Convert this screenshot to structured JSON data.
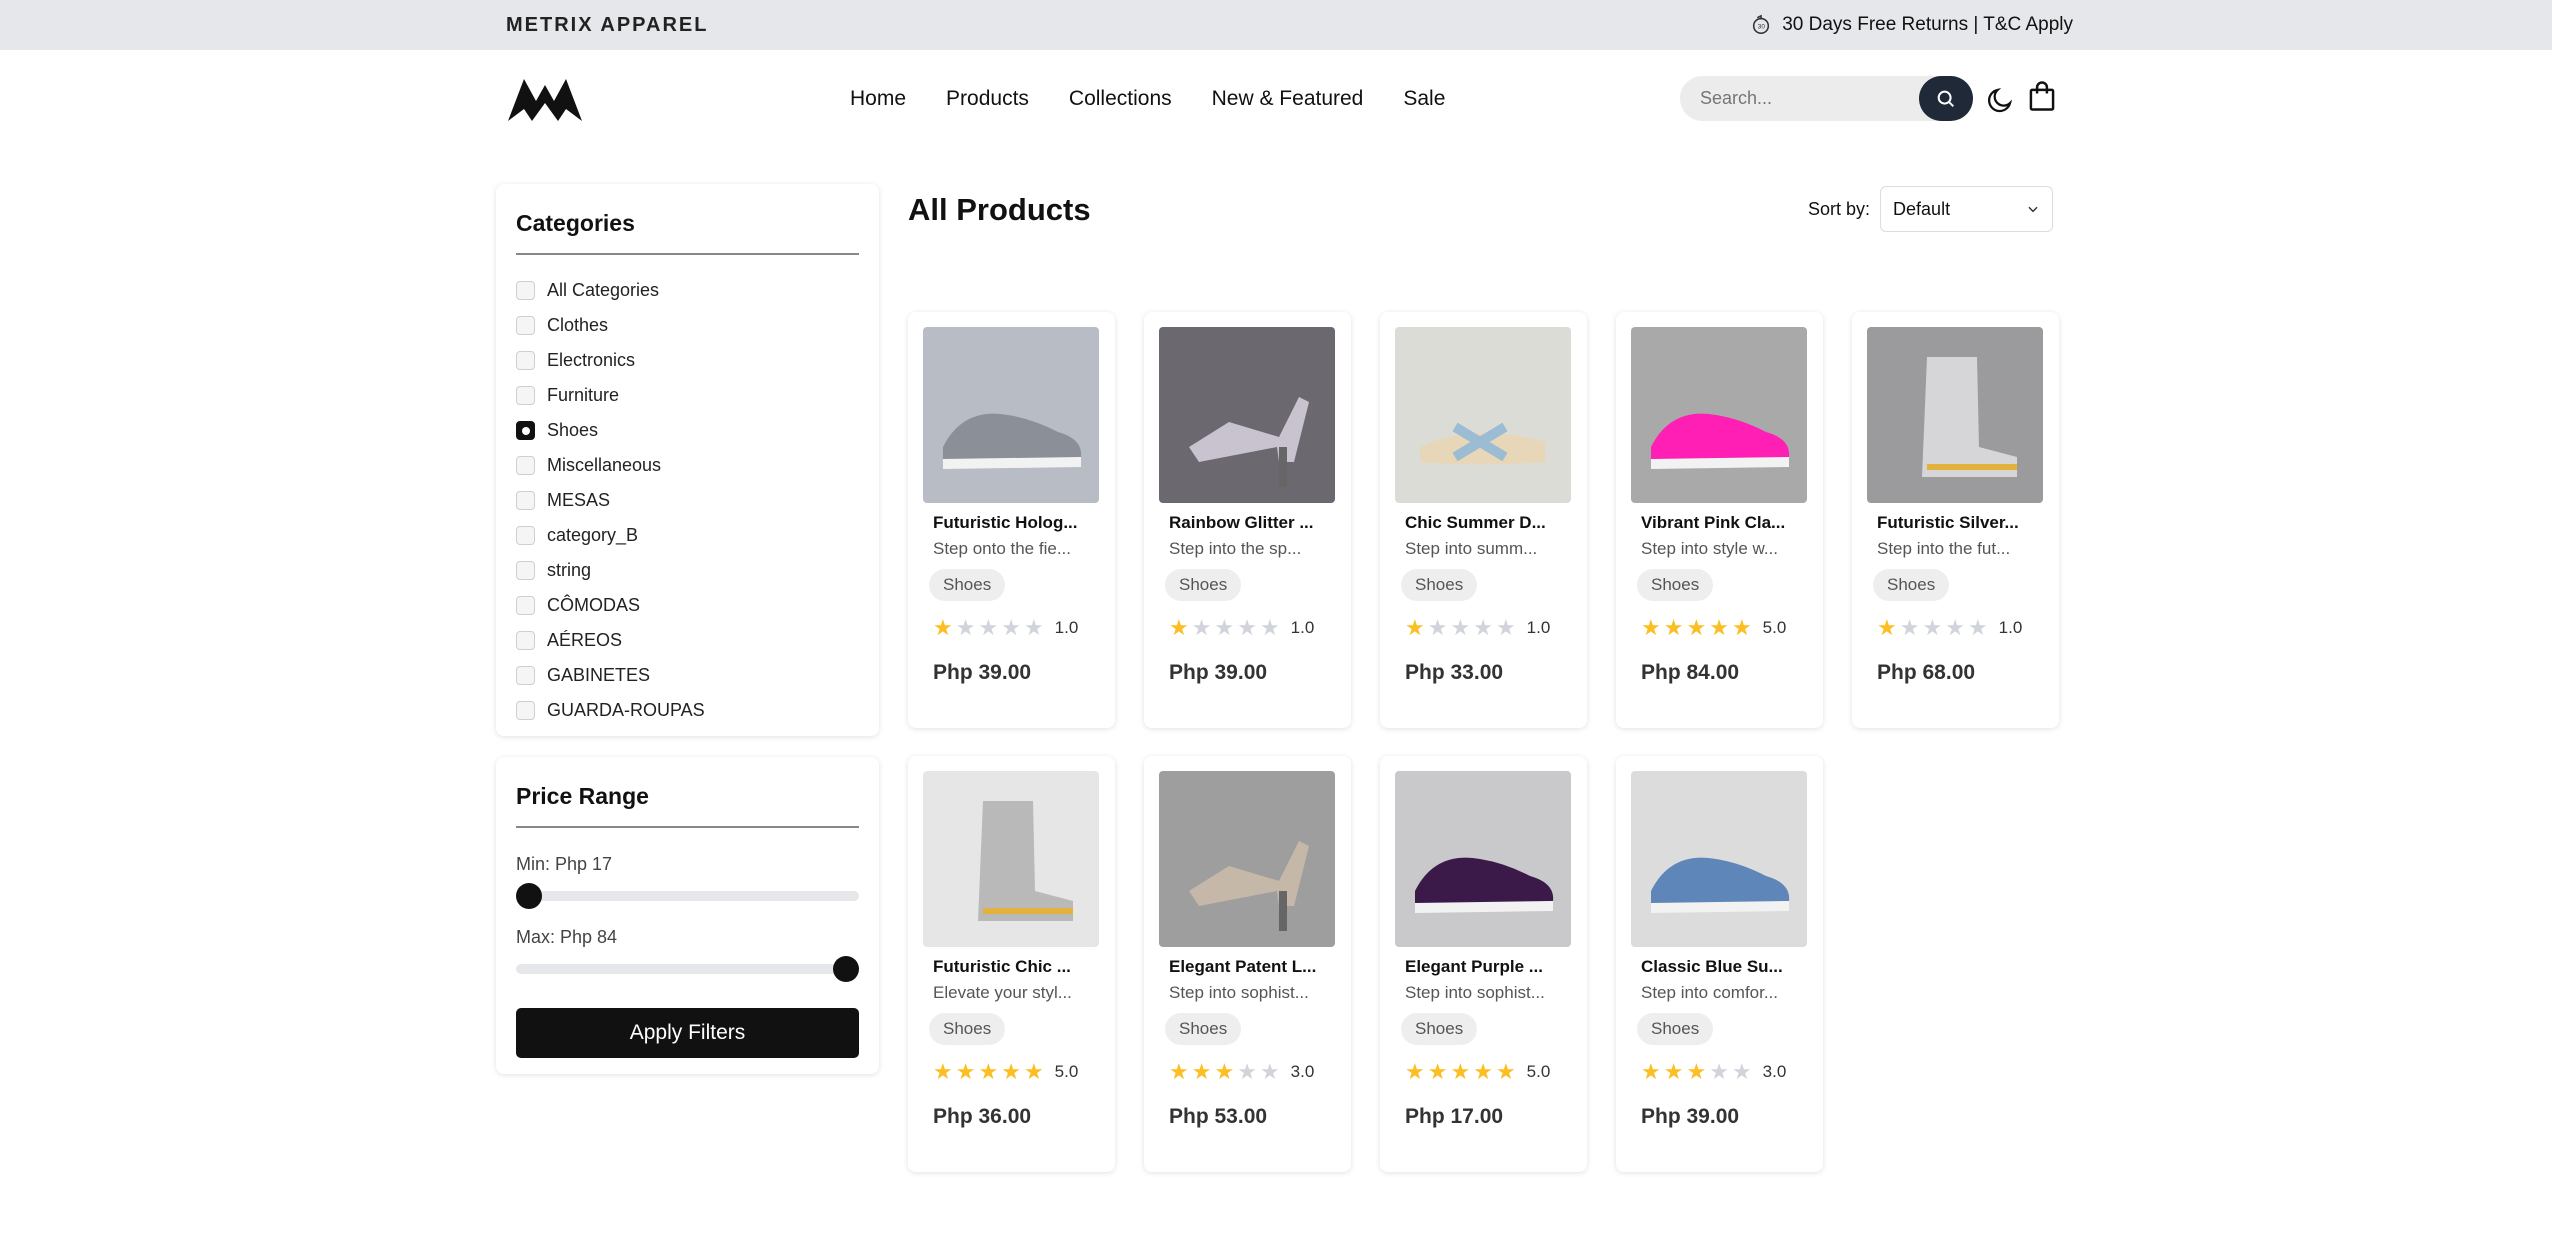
{
  "topbar": {
    "brand": "METRIX APPAREL",
    "promo": "30 Days Free Returns | T&C Apply"
  },
  "nav": [
    "Home",
    "Products",
    "Collections",
    "New & Featured",
    "Sale"
  ],
  "search": {
    "placeholder": "Search..."
  },
  "categories": {
    "title": "Categories",
    "items": [
      {
        "label": "All Categories",
        "checked": false
      },
      {
        "label": "Clothes",
        "checked": false
      },
      {
        "label": "Electronics",
        "checked": false
      },
      {
        "label": "Furniture",
        "checked": false
      },
      {
        "label": "Shoes",
        "checked": true
      },
      {
        "label": "Miscellaneous",
        "checked": false
      },
      {
        "label": "MESAS",
        "checked": false
      },
      {
        "label": "category_B",
        "checked": false
      },
      {
        "label": "string",
        "checked": false
      },
      {
        "label": "CÔMODAS",
        "checked": false
      },
      {
        "label": "AÉREOS",
        "checked": false
      },
      {
        "label": "GABINETES",
        "checked": false
      },
      {
        "label": "GUARDA-ROUPAS",
        "checked": false
      }
    ]
  },
  "price_range": {
    "title": "Price Range",
    "min_label": "Min: Php 17",
    "max_label": "Max: Php 84",
    "min_level": 0,
    "max_level": 1,
    "apply_label": "Apply Filters"
  },
  "main": {
    "title": "All Products",
    "sort_label": "Sort by:",
    "sort_value": "Default"
  },
  "products": [
    {
      "name": "Futuristic Holog...",
      "desc": "Step onto the fie...",
      "tag": "Shoes",
      "rating": 1,
      "rating_text": "1.0",
      "price": "Php 39.00",
      "img_icon": "holographic-sneaker",
      "bg": "#b8bcc4",
      "fg": "#8b8f98"
    },
    {
      "name": "Rainbow Glitter ...",
      "desc": "Step into the sp...",
      "tag": "Shoes",
      "rating": 1,
      "rating_text": "1.0",
      "price": "Php 39.00",
      "img_icon": "glitter-heel",
      "bg": "#6b6870",
      "fg": "#c9c3cf"
    },
    {
      "name": "Chic Summer D...",
      "desc": "Step into summ...",
      "tag": "Shoes",
      "rating": 1,
      "rating_text": "1.0",
      "price": "Php 33.00",
      "img_icon": "summer-sandal",
      "bg": "#dcdcd6",
      "fg": "#9bbcd2"
    },
    {
      "name": "Vibrant Pink Cla...",
      "desc": "Step into style w...",
      "tag": "Shoes",
      "rating": 5,
      "rating_text": "5.0",
      "price": "Php 84.00",
      "img_icon": "pink-sneaker",
      "bg": "#a9a9a9",
      "fg": "#ff1fb4"
    },
    {
      "name": "Futuristic Silver...",
      "desc": "Step into the fut...",
      "tag": "Shoes",
      "rating": 1,
      "rating_text": "1.0",
      "price": "Php 68.00",
      "img_icon": "silver-boot",
      "bg": "#9b9b9d",
      "fg": "#d6d6d8"
    },
    {
      "name": "Futuristic Chic ...",
      "desc": "Elevate your styl...",
      "tag": "Shoes",
      "rating": 5,
      "rating_text": "5.0",
      "price": "Php 36.00",
      "img_icon": "chic-boot",
      "bg": "#e6e6e6",
      "fg": "#b9b9b9"
    },
    {
      "name": "Elegant Patent L...",
      "desc": "Step into sophist...",
      "tag": "Shoes",
      "rating": 3,
      "rating_text": "3.0",
      "price": "Php 53.00",
      "img_icon": "patent-heel",
      "bg": "#9e9e9e",
      "fg": "#c6b8a8"
    },
    {
      "name": "Elegant Purple ...",
      "desc": "Step into sophist...",
      "tag": "Shoes",
      "rating": 5,
      "rating_text": "5.0",
      "price": "Php 17.00",
      "img_icon": "purple-loafer",
      "bg": "#c9c9cc",
      "fg": "#3b1a4a"
    },
    {
      "name": "Classic Blue Su...",
      "desc": "Step into comfor...",
      "tag": "Shoes",
      "rating": 3,
      "rating_text": "3.0",
      "price": "Php 39.00",
      "img_icon": "blue-suede-shoe",
      "bg": "#dcdcdc",
      "fg": "#5f86b8"
    }
  ],
  "colors": {
    "star": "#fbbf24",
    "star_empty": "#d1d5db",
    "dark": "#111111",
    "search_button": "#1f2937"
  }
}
